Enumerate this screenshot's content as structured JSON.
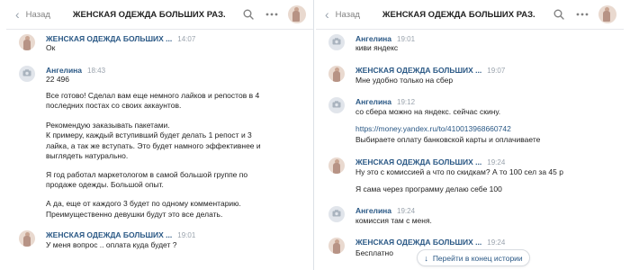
{
  "left": {
    "header": {
      "back_label": "Назад",
      "title": "ЖЕНСКАЯ ОДЕЖДА БОЛЬШИХ РАЗ..."
    },
    "messages": [
      {
        "author": "ЖЕНСКАЯ ОДЕЖДА БОЛЬШИХ ...",
        "time": "14:07",
        "lines": [
          "Ок"
        ]
      },
      {
        "author": "Ангелина",
        "time": "18:43",
        "lines": [
          "22 496",
          "Все готово! Сделал вам еще немного лайков и репостов в 4",
          "последних постах со своих аккаунтов.",
          "Рекомендую заказывать пакетами.",
          "К примеру, каждый вступивший будет делать 1 репост и 3",
          "лайка, а так же вступать. Это будет намного эффективнее и",
          "выглядеть натурально.",
          "Я год работал маркетологом в самой большой группе по",
          "продаже одежды. Большой опыт.",
          "А да, еще от каждого 3 будет по одному комментарию.",
          "Преимущественно девушки будут это все делать."
        ]
      },
      {
        "author": "ЖЕНСКАЯ ОДЕЖДА БОЛЬШИХ ...",
        "time": "19:01",
        "lines": [
          "У меня вопрос .. оплата куда будет ?"
        ]
      }
    ]
  },
  "right": {
    "header": {
      "back_label": "Назад",
      "title": "ЖЕНСКАЯ ОДЕЖДА БОЛЬШИХ РАЗ..."
    },
    "messages": [
      {
        "author": "Ангелина",
        "time": "19:01",
        "lines": [
          "киви яндекс"
        ]
      },
      {
        "author": "ЖЕНСКАЯ ОДЕЖДА БОЛЬШИХ ...",
        "time": "19:07",
        "lines": [
          "Мне удобно только на сбер"
        ]
      },
      {
        "author": "Ангелина",
        "time": "19:12",
        "lines": [
          "со сбера можно на яндекс. сейчас скину.",
          "https://money.yandex.ru/to/410013968660742",
          "Выбираете оплату банковской карты и оплачиваете"
        ]
      },
      {
        "author": "ЖЕНСКАЯ ОДЕЖДА БОЛЬШИХ ...",
        "time": "19:24",
        "lines": [
          "Ну это с комиссией а что по скидкам? А то 100 сел за 45 р",
          "Я сама через программу делаю себе 100"
        ]
      },
      {
        "author": "Ангелина",
        "time": "19:24",
        "lines": [
          "комиссия там с меня."
        ]
      },
      {
        "author": "ЖЕНСКАЯ ОДЕЖДА БОЛЬШИХ ...",
        "time": "19:24",
        "lines": [
          "Бесплатно"
        ]
      }
    ],
    "jump_to_end": "Перейти в конец истории"
  },
  "colors": {
    "link": "#2a5885",
    "muted": "#828282",
    "time": "#9aa3ad",
    "camera_bg": "#e1e5eb"
  },
  "icons": {
    "back": "chevron-left-icon",
    "search": "search-icon",
    "more": "more-dots-icon",
    "camera": "camera-icon",
    "jump": "arrow-down-icon"
  }
}
